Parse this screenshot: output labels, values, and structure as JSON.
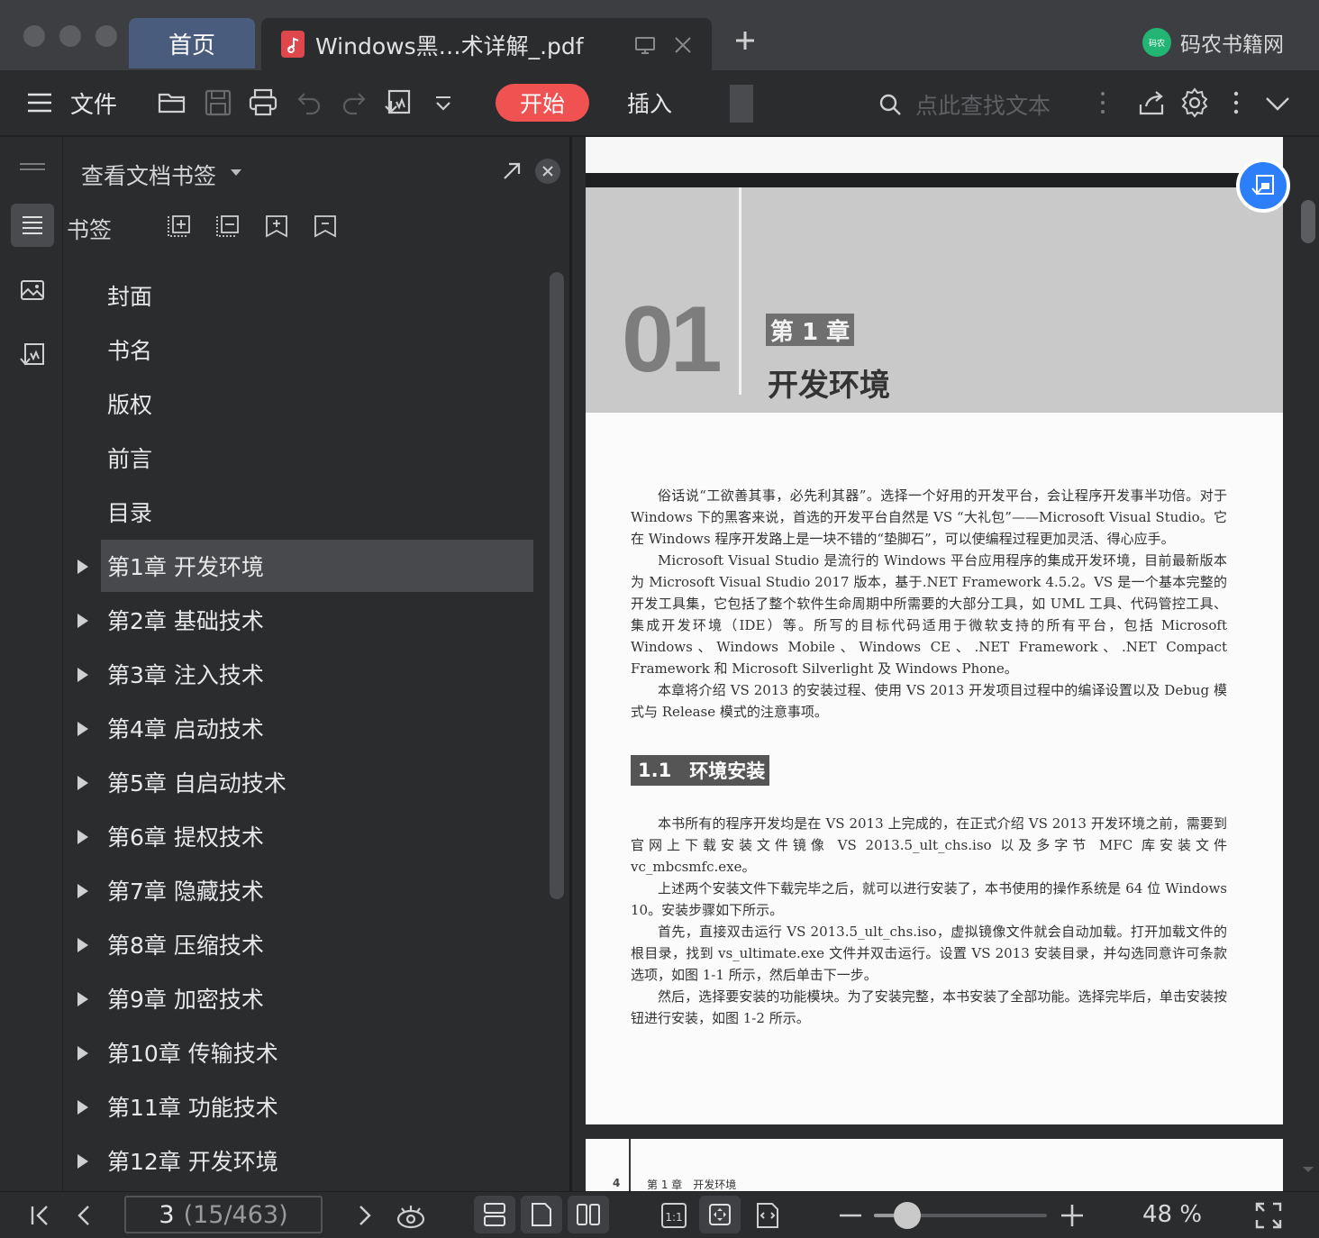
{
  "tabs": {
    "home_label": "首页",
    "doc_label": "Windows黑…术详解_.pdf"
  },
  "brand": {
    "logo_text": "码农",
    "name": "码农书籍网"
  },
  "toolbar": {
    "file_label": "文件",
    "start_label": "开始",
    "insert_label": "插入",
    "search_placeholder": "点此查找文本"
  },
  "bookmark_panel": {
    "title": "查看文档书签",
    "section_label": "书签",
    "items": [
      {
        "label": "封面",
        "expandable": false,
        "selected": false
      },
      {
        "label": "书名",
        "expandable": false,
        "selected": false
      },
      {
        "label": "版权",
        "expandable": false,
        "selected": false
      },
      {
        "label": "前言",
        "expandable": false,
        "selected": false
      },
      {
        "label": "目录",
        "expandable": false,
        "selected": false
      },
      {
        "label": "第1章 开发环境",
        "expandable": true,
        "selected": true
      },
      {
        "label": "第2章 基础技术",
        "expandable": true,
        "selected": false
      },
      {
        "label": "第3章 注入技术",
        "expandable": true,
        "selected": false
      },
      {
        "label": "第4章 启动技术",
        "expandable": true,
        "selected": false
      },
      {
        "label": "第5章 自启动技术",
        "expandable": true,
        "selected": false
      },
      {
        "label": "第6章 提权技术",
        "expandable": true,
        "selected": false
      },
      {
        "label": "第7章 隐藏技术",
        "expandable": true,
        "selected": false
      },
      {
        "label": "第8章 压缩技术",
        "expandable": true,
        "selected": false
      },
      {
        "label": "第9章 加密技术",
        "expandable": true,
        "selected": false
      },
      {
        "label": "第10章 传输技术",
        "expandable": true,
        "selected": false
      },
      {
        "label": "第11章 功能技术",
        "expandable": true,
        "selected": false
      },
      {
        "label": "第12章 开发环境",
        "expandable": true,
        "selected": false
      }
    ]
  },
  "document": {
    "chapter_number": "01",
    "chapter_tag": "第 1 章",
    "chapter_title": "开发环境",
    "intro_paragraphs": [
      "俗话说“工欲善其事，必先利其器”。选择一个好用的开发平台，会让程序开发事半功倍。对于 Windows 下的黑客来说，首选的开发平台自然是 VS “大礼包”——Microsoft Visual Studio。它在 Windows 程序开发路上是一块不错的“垫脚石”，可以使编程过程更加灵活、得心应手。",
      "Microsoft Visual Studio 是流行的 Windows 平台应用程序的集成开发环境，目前最新版本为 Microsoft Visual Studio 2017 版本，基于.NET Framework 4.5.2。VS 是一个基本完整的开发工具集，它包括了整个软件生命周期中所需要的大部分工具，如 UML 工具、代码管控工具、集成开发环境（IDE）等。所写的目标代码适用于微软支持的所有平台，包括 Microsoft Windows、Windows Mobile、Windows CE、.NET Framework、.NET Compact Framework 和 Microsoft Silverlight 及 Windows Phone。",
      "本章将介绍 VS 2013 的安装过程、使用 VS 2013 开发项目过程中的编译设置以及 Debug 模式与 Release 模式的注意事项。"
    ],
    "section_number": "1.1",
    "section_title": "环境安装",
    "section_paragraphs": [
      "本书所有的程序开发均是在 VS 2013 上完成的，在正式介绍 VS 2013 开发环境之前，需要到官网上下载安装文件镜像 VS 2013.5_ult_chs.iso 以及多字节 MFC 库安装文件 vc_mbcsmfc.exe。",
      "上述两个安装文件下载完毕之后，就可以进行安装了，本书使用的操作系统是 64 位 Windows 10。安装步骤如下所示。",
      "首先，直接双击运行 VS 2013.5_ult_chs.iso，虚拟镜像文件就会自动加载。打开加载文件的根目录，找到 vs_ultimate.exe 文件并双击运行。设置 VS 2013 安装目录，并勾选同意许可条款选项，如图 1-1 所示，然后单击下一步。",
      "然后，选择要安装的功能模块。为了安装完整，本书安装了全部功能。选择完毕后，单击安装按钮进行安装，如图 1-2 所示。"
    ],
    "next_page_number": "4",
    "next_page_running_head": "第 1 章　开发环境"
  },
  "statusbar": {
    "current_page": "3",
    "page_total": "(15/463)",
    "zoom_level": 0.48,
    "zoom_label": "48 %"
  },
  "colors": {
    "accent_red": "#f05151",
    "home_tab": "#4a5c7e",
    "float_button": "#2d7ff9"
  }
}
